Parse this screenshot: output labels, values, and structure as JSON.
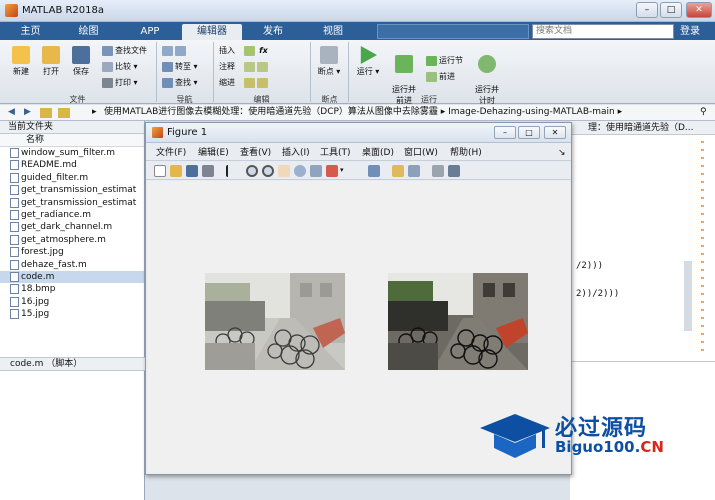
{
  "app": {
    "title": "MATLAB R2018a"
  },
  "tabs": [
    {
      "label": "主页"
    },
    {
      "label": "绘图"
    },
    {
      "label": "APP"
    },
    {
      "label": "编辑器"
    },
    {
      "label": "发布"
    },
    {
      "label": "视图"
    }
  ],
  "search": {
    "placeholder": "搜索文档"
  },
  "login_label": "登录",
  "ribbon": {
    "file_group": {
      "label": "文件",
      "new": "新建",
      "open": "打开",
      "save": "保存",
      "find_files": "查找文件",
      "compare": "比较",
      "print": "打印"
    },
    "nav_group": {
      "label": "导航",
      "goto": "转至",
      "find": "查找"
    },
    "edit_group": {
      "label": "编辑",
      "insert": "插入",
      "comment": "注释",
      "indent": "缩进"
    },
    "breakpoint_group": {
      "label": "断点",
      "breakpoints": "断点"
    },
    "run_group": {
      "label": "运行",
      "run": "运行",
      "run_advance": "运行并\n前进",
      "run_section": "运行节",
      "advance": "前进",
      "run_time": "运行并\n计时"
    }
  },
  "address": {
    "path": "使用MATLAB进行图像去模糊处理：使用暗通道先验（DCP）算法从图像中去除雾霾  ▸  Image-Dehazing-using-MATLAB-main  ▸"
  },
  "current_folder": {
    "title": "当前文件夹",
    "column": "名称",
    "files": [
      {
        "name": "window_sum_filter.m",
        "selected": false
      },
      {
        "name": "README.md",
        "selected": false
      },
      {
        "name": "guided_filter.m",
        "selected": false
      },
      {
        "name": "get_transmission_estimat",
        "selected": false
      },
      {
        "name": "get_transmission_estimat",
        "selected": false
      },
      {
        "name": "get_radiance.m",
        "selected": false
      },
      {
        "name": "get_dark_channel.m",
        "selected": false
      },
      {
        "name": "get_atmosphere.m",
        "selected": false
      },
      {
        "name": "forest.jpg",
        "selected": false
      },
      {
        "name": "dehaze_fast.m",
        "selected": false
      },
      {
        "name": "code.m",
        "selected": true
      },
      {
        "name": "18.bmp",
        "selected": false
      },
      {
        "name": "16.jpg",
        "selected": false
      },
      {
        "name": "15.jpg",
        "selected": false
      }
    ],
    "details": "code.m （脚本）"
  },
  "editor": {
    "title": "理：使用暗通道先验（D...",
    "lines": [
      "/2)))",
      "2))/2)))"
    ]
  },
  "figure": {
    "title": "Figure 1",
    "menu": [
      "文件(F)",
      "编辑(E)",
      "查看(V)",
      "插入(I)",
      "工具(T)",
      "桌面(D)",
      "窗口(W)",
      "帮助(H)"
    ]
  },
  "watermark": {
    "cn": "必过源码",
    "url_main": "Biguo100.",
    "url_cn": "CN"
  }
}
